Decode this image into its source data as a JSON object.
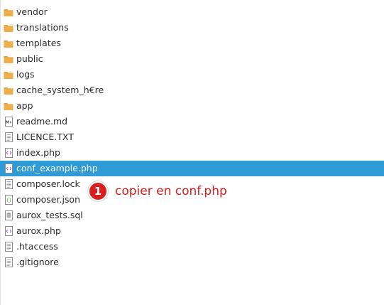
{
  "files": [
    {
      "name": "vendor",
      "type": "folder",
      "icon": "folder-icon"
    },
    {
      "name": "translations",
      "type": "folder",
      "icon": "folder-icon"
    },
    {
      "name": "templates",
      "type": "folder",
      "icon": "folder-icon"
    },
    {
      "name": "public",
      "type": "folder",
      "icon": "folder-icon"
    },
    {
      "name": "logs",
      "type": "folder",
      "icon": "folder-icon"
    },
    {
      "name": "cache_system_h€re",
      "type": "folder",
      "icon": "folder-icon"
    },
    {
      "name": "app",
      "type": "folder",
      "icon": "folder-icon"
    },
    {
      "name": "readme.md",
      "type": "markdown",
      "icon": "markdown-file-icon"
    },
    {
      "name": "LICENCE.TXT",
      "type": "text",
      "icon": "text-file-icon"
    },
    {
      "name": "index.php",
      "type": "code",
      "icon": "code-file-icon"
    },
    {
      "name": "conf_example.php",
      "type": "code",
      "icon": "code-file-icon",
      "selected": true
    },
    {
      "name": "composer.lock",
      "type": "text",
      "icon": "text-file-icon"
    },
    {
      "name": "composer.json",
      "type": "json",
      "icon": "json-file-icon"
    },
    {
      "name": "aurox_tests.sql",
      "type": "database",
      "icon": "database-file-icon"
    },
    {
      "name": "aurox.php",
      "type": "code",
      "icon": "code-file-icon"
    },
    {
      "name": ".htaccess",
      "type": "text",
      "icon": "text-file-icon"
    },
    {
      "name": ".gitignore",
      "type": "text",
      "icon": "text-file-icon"
    }
  ],
  "annotation": {
    "number": "1",
    "text": "copier en conf.php"
  },
  "colors": {
    "folder": "#e8a33d",
    "selection": "#2e9ad6",
    "annotation": "#d32020"
  }
}
